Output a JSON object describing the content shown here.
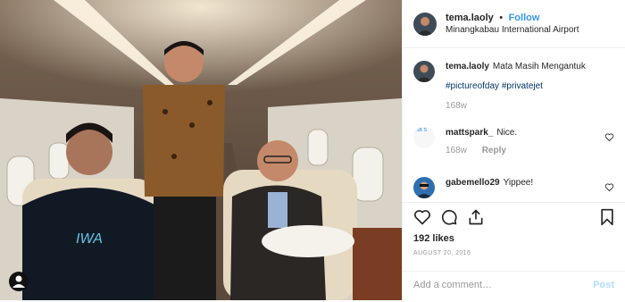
{
  "post": {
    "username": "tema.laoly",
    "follow_label": "Follow",
    "separator": "•",
    "location": "Minangkabau International Airport"
  },
  "caption": {
    "username": "tema.laoly",
    "text": "Mata Masih Mengantuk",
    "hashtags": "#pictureofday #privatejet",
    "time": "168w"
  },
  "comments": [
    {
      "username": "mattspark_",
      "text": "Nice.",
      "time": "168w",
      "reply_label": "Reply",
      "avatar_label": "ma s"
    },
    {
      "username": "gabemello29",
      "text": "Yippee!"
    }
  ],
  "likes": "192 likes",
  "date": "AUGUST 20, 2016",
  "add_comment_placeholder": "Add a comment…",
  "post_button": "Post",
  "icons": [
    "heart-icon",
    "comment-icon",
    "share-icon",
    "bookmark-icon",
    "profile-icon"
  ],
  "colors": {
    "link": "#3897f0",
    "hashtag": "#003569",
    "muted": "#999999",
    "post_disabled": "#b2dffc"
  }
}
